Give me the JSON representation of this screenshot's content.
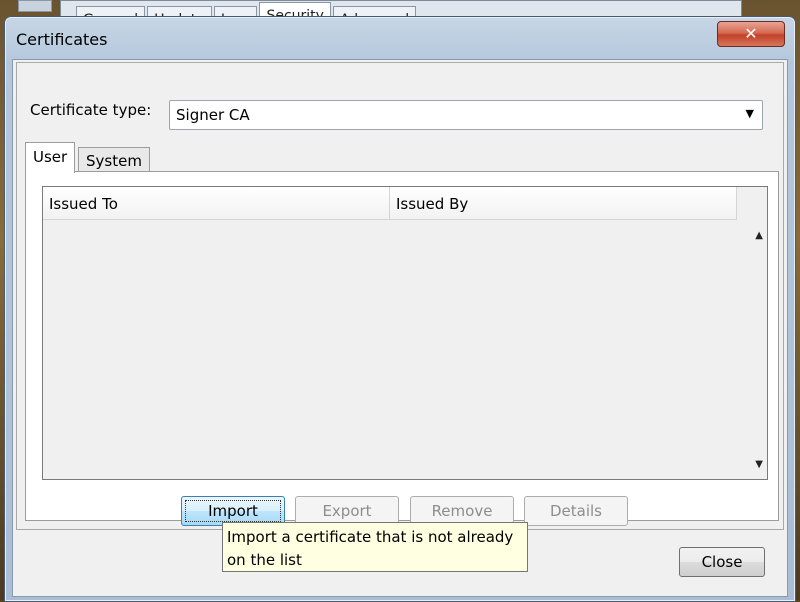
{
  "background_window": {
    "tabs": [
      "General",
      "Update",
      "Java",
      "Security",
      "Advanced"
    ],
    "active_tab": "Security"
  },
  "dialog": {
    "title": "Certificates",
    "close_glyph": "✕"
  },
  "certificate_type": {
    "label": "Certificate type:",
    "selected": "Signer CA"
  },
  "tabs": {
    "user": "User",
    "system": "System",
    "active": "User"
  },
  "table": {
    "columns": [
      "Issued To",
      "Issued By"
    ],
    "rows": []
  },
  "buttons": {
    "import": "Import",
    "export": "Export",
    "remove": "Remove",
    "details": "Details",
    "close": "Close"
  },
  "tooltip": {
    "text": "Import a certificate that is not already on the list"
  },
  "icons": {
    "dropdown": "chevron-down-icon",
    "scroll_up": "scroll-up-arrow-icon",
    "scroll_down": "scroll-down-arrow-icon",
    "close": "close-icon"
  }
}
